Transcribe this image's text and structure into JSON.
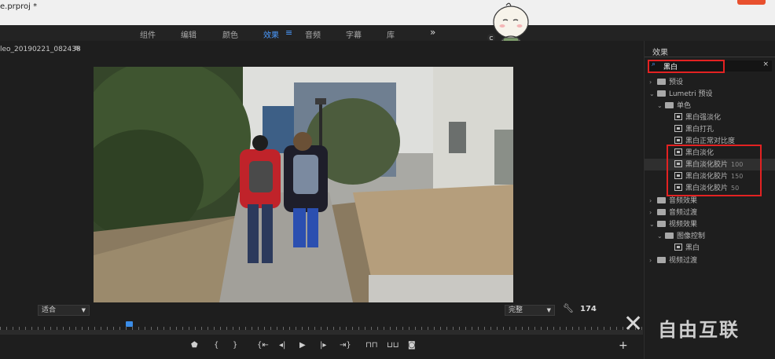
{
  "window": {
    "title": "e.prproj *"
  },
  "workspaces": {
    "tabs": [
      "组件",
      "编辑",
      "颜色",
      "效果",
      "音频",
      "字幕",
      "库"
    ],
    "active": "效果",
    "more": "»"
  },
  "monitor": {
    "sequence_name": "leo_20190221_082438",
    "sequence_menu": "≡",
    "fit_value": "适合",
    "quality_value": "完整",
    "frame_number": "174",
    "playhead_fraction": 0.196
  },
  "transport": {
    "buttons": [
      "marker",
      "mark-in",
      "mark-out",
      "go-to-in",
      "step-back",
      "play",
      "step-forward",
      "go-to-out",
      "lift",
      "extract",
      "export-frame"
    ],
    "add": "+"
  },
  "effects": {
    "header": "效果",
    "search_value": "黑白",
    "clear": "×",
    "tree": [
      {
        "label": "预设",
        "depth": 0,
        "expanded": false,
        "kind": "folder"
      },
      {
        "label": "Lumetri 预设",
        "depth": 0,
        "expanded": true,
        "kind": "folder"
      },
      {
        "label": "单色",
        "depth": 1,
        "expanded": true,
        "kind": "folder"
      },
      {
        "label": "黑白强淡化",
        "depth": 2,
        "kind": "preset"
      },
      {
        "label": "黑白打孔",
        "depth": 2,
        "kind": "preset"
      },
      {
        "label": "黑白正常对比度",
        "depth": 2,
        "kind": "preset"
      },
      {
        "label": "黑白淡化",
        "depth": 2,
        "kind": "preset"
      },
      {
        "label": "黑白淡化胶片",
        "badge": "100",
        "depth": 2,
        "kind": "preset",
        "selected": true
      },
      {
        "label": "黑白淡化胶片",
        "badge": "150",
        "depth": 2,
        "kind": "preset"
      },
      {
        "label": "黑白淡化胶片",
        "badge": "50",
        "depth": 2,
        "kind": "preset"
      },
      {
        "label": "音频效果",
        "depth": 0,
        "expanded": false,
        "kind": "folder"
      },
      {
        "label": "音频过渡",
        "depth": 0,
        "expanded": false,
        "kind": "folder"
      },
      {
        "label": "视频效果",
        "depth": 0,
        "expanded": true,
        "kind": "folder"
      },
      {
        "label": "图像控制",
        "depth": 1,
        "expanded": true,
        "kind": "folder"
      },
      {
        "label": "黑白",
        "depth": 2,
        "kind": "effect"
      },
      {
        "label": "视频过渡",
        "depth": 0,
        "expanded": false,
        "kind": "folder"
      }
    ]
  },
  "watermark": {
    "text": "自由互联"
  },
  "colors": {
    "accent": "#4b9bff",
    "highlight": "#e32222"
  }
}
